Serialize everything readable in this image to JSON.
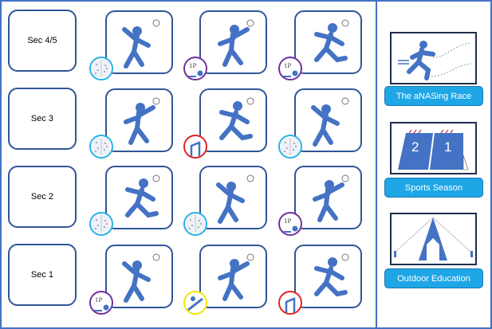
{
  "colors": {
    "border": "#4472c4",
    "tile_border": "#2f5597",
    "icon": "#4472c4",
    "button": "#1ea6e6"
  },
  "badge_colors": {
    "gym": "#29b1e6",
    "individual": "#7030a0",
    "hurdle": "#e02424",
    "bat": "#f2e600"
  },
  "badge_text": {
    "individual": "1P"
  },
  "rows": [
    {
      "label": "Sec 4/5",
      "tiles": [
        {
          "icon": "handball-icon",
          "badge": "gym"
        },
        {
          "icon": "rock-climbing-icon",
          "badge": "individual"
        },
        {
          "icon": "running-icon",
          "badge": "individual"
        }
      ]
    },
    {
      "label": "Sec 3",
      "tiles": [
        {
          "icon": "floorball-goal-icon",
          "badge": "gym"
        },
        {
          "icon": "volleyball-net-icon",
          "badge": "hurdle"
        },
        {
          "icon": "frisbee-icon",
          "badge": "gym"
        }
      ]
    },
    {
      "label": "Sec 2",
      "tiles": [
        {
          "icon": "badminton-icon",
          "badge": "gym"
        },
        {
          "icon": "netball-icon",
          "badge": "gym"
        },
        {
          "icon": "stretching-icon",
          "badge": "individual"
        }
      ]
    },
    {
      "label": "Sec 1",
      "tiles": [
        {
          "icon": "gymnastics-icon",
          "badge": "individual"
        },
        {
          "icon": "softball-batting-icon",
          "badge": "bat"
        },
        {
          "icon": "table-tennis-icon",
          "badge": "hurdle"
        }
      ]
    }
  ],
  "activities": [
    {
      "label": "The  aNASing Race",
      "icon": "race-runner-icon"
    },
    {
      "label": "Sports Season",
      "icon": "calendar-icon",
      "calendar": [
        "2",
        "1"
      ]
    },
    {
      "label": "Outdoor Education",
      "icon": "tent-icon"
    }
  ]
}
